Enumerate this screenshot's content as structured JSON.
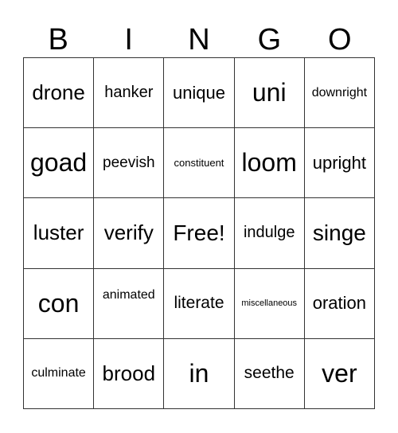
{
  "header": [
    "B",
    "I",
    "N",
    "G",
    "O"
  ],
  "cells": [
    [
      "drone",
      "hanker",
      "unique",
      "uni",
      "downright"
    ],
    [
      "goad",
      "peevish",
      "constituent",
      "loom",
      "upright"
    ],
    [
      "luster",
      "verify",
      "Free!",
      "indulge",
      "singe"
    ],
    [
      "con",
      "animated",
      "literate",
      "miscellaneous",
      "oration"
    ],
    [
      "culminate",
      "brood",
      "in",
      "seethe",
      "ver"
    ]
  ]
}
